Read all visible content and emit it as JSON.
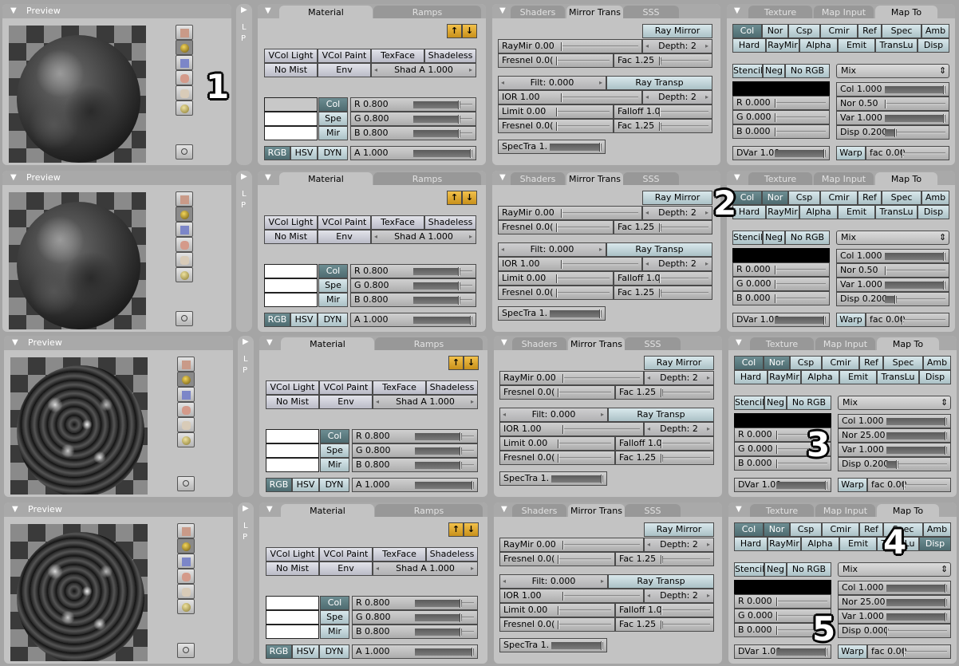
{
  "colors": {
    "background": "#a5a5a5",
    "panel": "#c3c3c3",
    "toggle_active": "#5b7b80",
    "toggle": "#c0d4d8",
    "button": "#cfd0da"
  },
  "preview": {
    "title": "Preview",
    "icons": [
      "plane-icon",
      "sphere-icon",
      "cube-icon",
      "monkey-icon",
      "hair-icon",
      "sky-sphere-icon"
    ],
    "active_icon": "sphere-icon",
    "render_button": "circle-icon"
  },
  "lp_strip": {
    "labels": [
      "L",
      "P"
    ]
  },
  "material": {
    "tabs": [
      "Material",
      "Ramps"
    ],
    "active_tab": "Material",
    "toggles": [
      "VCol Light",
      "VCol Paint",
      "TexFace",
      "Shadeless",
      "No Mist",
      "Env"
    ],
    "shad_a": "Shad A 1.000",
    "color_buttons": [
      "Col",
      "Spe",
      "Mir"
    ],
    "active_color_button": "Col",
    "sliders": [
      {
        "label": "R 0.800",
        "level": 0.8
      },
      {
        "label": "G 0.800",
        "level": 0.8
      },
      {
        "label": "B 0.800",
        "level": 0.8
      }
    ],
    "modes": [
      "RGB",
      "HSV",
      "DYN"
    ],
    "active_mode": "RGB",
    "alpha": {
      "label": "A 1.000",
      "level": 1.0
    }
  },
  "mirror": {
    "tabs": [
      "Shaders",
      "Mirror Trans",
      "SSS"
    ],
    "active_tab": "Mirror Trans",
    "ray_mirror": "Ray Mirror",
    "raymir": {
      "label": "RayMir 0.00",
      "level": 0
    },
    "depth1": "Depth: 2",
    "fresnel1": {
      "label": "Fresnel 0.0(",
      "level": 0
    },
    "fac1": {
      "label": "Fac 1.25",
      "level": 0.05
    },
    "filt": "Filt: 0.000",
    "ray_transp": "Ray Transp",
    "ior": {
      "label": "IOR 1.00",
      "level": 0
    },
    "depth2": "Depth: 2",
    "limit": {
      "label": "Limit 0.00",
      "level": 0
    },
    "falloff": {
      "label": "Falloff 1.0",
      "level": 0
    },
    "fresnel2": {
      "label": "Fresnel 0.0(",
      "level": 0
    },
    "fac2": {
      "label": "Fac 1.25",
      "level": 0.05
    },
    "spectra": {
      "label": "SpecTra 1.",
      "level": 1
    }
  },
  "mapto": {
    "tabs": [
      "Texture",
      "Map Input",
      "Map To"
    ],
    "active_tab": "Map To",
    "channels": [
      "Col",
      "Nor",
      "Csp",
      "Cmir",
      "Ref",
      "Spec",
      "Amb",
      "Hard",
      "RayMir",
      "Alpha",
      "Emit",
      "TransLu",
      "Disp"
    ],
    "flags": [
      "Stencil",
      "Neg",
      "No RGB"
    ],
    "swatch": "#000000",
    "rgb": [
      {
        "label": "R 0.000",
        "level": 0
      },
      {
        "label": "G 0.000",
        "level": 0
      },
      {
        "label": "B 0.000",
        "level": 0
      }
    ],
    "dvar": {
      "label": "DVar 1.00",
      "level": 1
    },
    "blend": "Mix",
    "col": {
      "label": "Col 1.000",
      "level": 1
    },
    "var": {
      "label": "Var 1.000",
      "level": 1
    },
    "warp": "Warp",
    "warp_fac": {
      "label": "fac 0.00",
      "level": 0
    }
  },
  "rows": [
    {
      "annotations": [
        "1"
      ],
      "active_channels": [
        "Col"
      ],
      "nor": {
        "label": "Nor 0.50",
        "level": 0.02
      },
      "disp": {
        "label": "Disp 0.200",
        "level": 0.2
      },
      "material_swatch": "#c8c8c8",
      "preview_style": "smooth"
    },
    {
      "annotations": [
        "2"
      ],
      "active_channels": [
        "Col",
        "Nor"
      ],
      "nor": {
        "label": "Nor 0.50",
        "level": 0.02
      },
      "disp": {
        "label": "Disp 0.200",
        "level": 0.2
      },
      "material_swatch": "#ffffff",
      "preview_style": "smooth"
    },
    {
      "annotations": [
        "3"
      ],
      "active_channels": [
        "Col",
        "Nor"
      ],
      "nor": {
        "label": "Nor 25.00",
        "level": 1
      },
      "disp": {
        "label": "Disp 0.200",
        "level": 0.2
      },
      "material_swatch": "#ffffff",
      "preview_style": "bumpy"
    },
    {
      "annotations": [
        "4",
        "5"
      ],
      "active_channels": [
        "Col",
        "Nor",
        "Disp"
      ],
      "nor": {
        "label": "Nor 25.00",
        "level": 1
      },
      "disp": {
        "label": "Disp 0.000",
        "level": 0
      },
      "material_swatch": "#ffffff",
      "preview_style": "displaced"
    }
  ]
}
